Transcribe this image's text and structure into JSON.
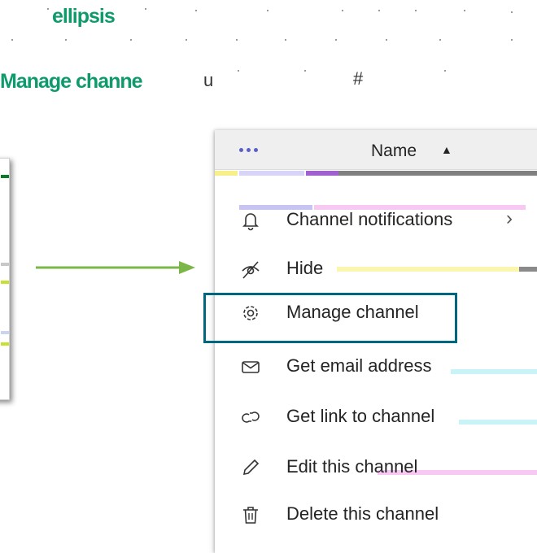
{
  "heading_top": "ellipsis",
  "heading_mid": "Manage channe",
  "stray_u": "u",
  "stray_hash": "#",
  "menu": {
    "header": {
      "more_label": "•••",
      "column": "Name",
      "sort_glyph": "▲"
    },
    "items": [
      {
        "label": "Channel notifications",
        "icon": "bell-icon",
        "has_submenu": true,
        "chevron": "›"
      },
      {
        "label": "Hide",
        "icon": "eye-off-icon"
      },
      {
        "label": "Manage channel",
        "icon": "gear-icon",
        "highlighted": true
      },
      {
        "label": "Get email address",
        "icon": "mail-icon"
      },
      {
        "label": "Get link to channel",
        "icon": "link-icon"
      },
      {
        "label": "Edit this channel",
        "icon": "pencil-icon"
      },
      {
        "label": "Delete this channel",
        "icon": "trash-icon"
      }
    ]
  },
  "colors": {
    "accent": "#0f9a6e",
    "highlight_border": "#00677f",
    "arrow": "#7ab648",
    "dots": "#5b5fc7"
  }
}
